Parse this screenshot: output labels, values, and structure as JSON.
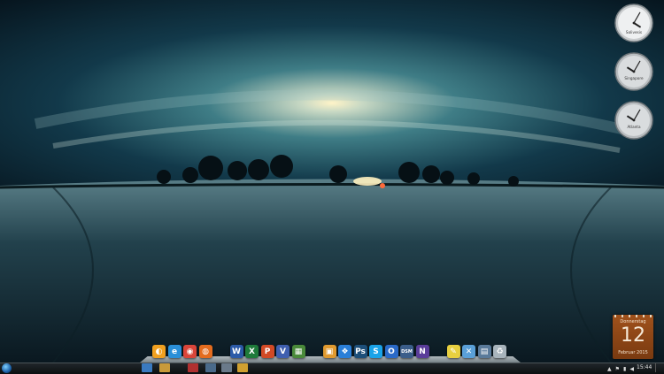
{
  "gadgets": {
    "clocks": [
      {
        "city": "Solivesis",
        "hour": 4,
        "minute": 5
      },
      {
        "city": "Singapore",
        "hour": 10,
        "minute": 5
      },
      {
        "city": "Atlanta",
        "hour": 10,
        "minute": 5
      }
    ],
    "calendar": {
      "weekday": "Donnerstag",
      "day": "12",
      "month_year": "Februar 2015"
    }
  },
  "dock": {
    "items": [
      {
        "name": "clip-icon",
        "glyph": "◐",
        "color": "#f0a020"
      },
      {
        "name": "internet-explorer-icon",
        "glyph": "e",
        "color": "#2a8fd8"
      },
      {
        "name": "chrome-icon",
        "glyph": "◉",
        "color": "#d9453a"
      },
      {
        "name": "firefox-icon",
        "glyph": "◍",
        "color": "#e46c1e"
      },
      {
        "name": "word-icon",
        "glyph": "W",
        "color": "#2b5aa8"
      },
      {
        "name": "excel-icon",
        "glyph": "X",
        "color": "#1e7a3a"
      },
      {
        "name": "powerpoint-icon",
        "glyph": "P",
        "color": "#d24a26"
      },
      {
        "name": "visio-icon",
        "glyph": "V",
        "color": "#3f5fb0"
      },
      {
        "name": "project-icon",
        "glyph": "▦",
        "color": "#4a8a3a"
      },
      {
        "name": "folder-icon",
        "glyph": "▣",
        "color": "#e09a30"
      },
      {
        "name": "dropbox-icon",
        "glyph": "❖",
        "color": "#2a7fd8"
      },
      {
        "name": "photoshop-icon",
        "glyph": "Ps",
        "color": "#1d4f7a"
      },
      {
        "name": "skype-icon",
        "glyph": "S",
        "color": "#1aa3e8"
      },
      {
        "name": "outlook-icon",
        "glyph": "O",
        "color": "#2a6ac8"
      },
      {
        "name": "dsm-icon",
        "glyph": "DSM",
        "color": "#3a5d8a"
      },
      {
        "name": "onenote-icon",
        "glyph": "N",
        "color": "#5a3d9a"
      },
      {
        "name": "notes-icon",
        "glyph": "✎",
        "color": "#e8d040"
      },
      {
        "name": "tools-icon",
        "glyph": "✕",
        "color": "#5aa0d8"
      },
      {
        "name": "network-icon",
        "glyph": "▤",
        "color": "#5a7a9a"
      },
      {
        "name": "recycle-bin-icon",
        "glyph": "♻",
        "color": "#a8b4bc"
      }
    ]
  },
  "taskbar": {
    "time": "15:44",
    "buttons": [
      {
        "name": "taskbar-explorer",
        "color": "#3a7ac0"
      },
      {
        "name": "taskbar-folder",
        "color": "#c89a3a"
      },
      {
        "name": "taskbar-media",
        "color": "#b03030"
      },
      {
        "name": "taskbar-app1",
        "color": "#4a6a8a"
      },
      {
        "name": "taskbar-app2",
        "color": "#6a7a8a"
      },
      {
        "name": "taskbar-app3",
        "color": "#d0a030"
      }
    ]
  }
}
